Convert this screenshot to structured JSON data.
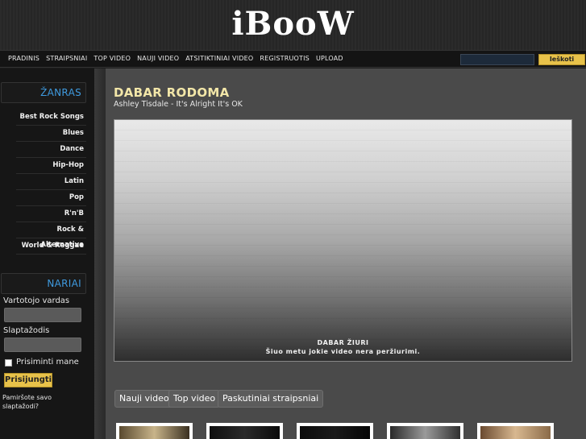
{
  "site": {
    "logo": "iBooW"
  },
  "nav": {
    "links": [
      "PRADINIS",
      "STRAIPSNIAI",
      "TOP VIDEO",
      "NAUJI VIDEO",
      "ATSITIKTINIAI VIDEO",
      "REGISTRUOTIS",
      "UPLOAD"
    ],
    "search_placeholder": "",
    "search_button": "Ieškoti"
  },
  "sidebar": {
    "genres_heading": "ŽANRAS",
    "genres": [
      "Best Rock Songs",
      "Blues",
      "Dance",
      "Hip-Hop",
      "Latin",
      "Pop",
      "R'n'B",
      "Rock & Alternative",
      "World & Reggae"
    ],
    "members_heading": "NARIAI",
    "username_label": "Vartotojo vardas",
    "password_label": "Slaptažodis",
    "remember_label": "Prisiminti mane",
    "login_button": "Prisijungti",
    "forgot_link": "Pamiršote savo slaptažodi?"
  },
  "main": {
    "now_title": "DABAR RODOMA",
    "now_subtitle": "Ashley Tisdale - It's Alright It's OK",
    "player_heading": "DABAR ŽIURI",
    "player_message": "Šiuo metu jokie video nera peržiurimi.",
    "tabs": [
      "Nauji video",
      "Top video",
      "Paskutiniai straipsniai"
    ]
  },
  "colors": {
    "accent_blue": "#3f9be0",
    "accent_gold": "#e8c24a",
    "title_cream": "#f2e6a8"
  }
}
